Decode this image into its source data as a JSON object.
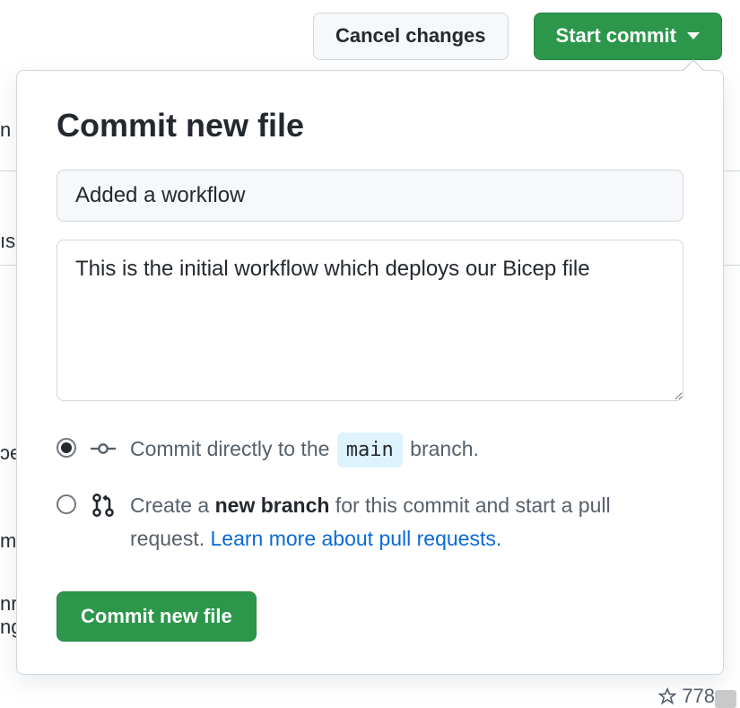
{
  "topbar": {
    "cancel_label": "Cancel changes",
    "start_commit_label": "Start commit"
  },
  "popover": {
    "title": "Commit new file",
    "commit_summary_value": "Added a workflow",
    "commit_description_value": "This is the initial workflow which deploys our Bicep file",
    "radio_direct": {
      "prefix": "Commit directly to the ",
      "branch": "main",
      "suffix": " branch."
    },
    "radio_newbranch": {
      "part1": "Create a ",
      "bold": "new branch",
      "part2": " for this commit and start a pull request. ",
      "link": "Learn more about pull requests."
    },
    "commit_button_label": "Commit new file"
  },
  "background": {
    "frag1": "n",
    "frag2": "ıs",
    "frag3": "ɔe",
    "frag4": "m",
    "frag5a": "nr",
    "frag5b": "ng",
    "star_count": "778"
  }
}
